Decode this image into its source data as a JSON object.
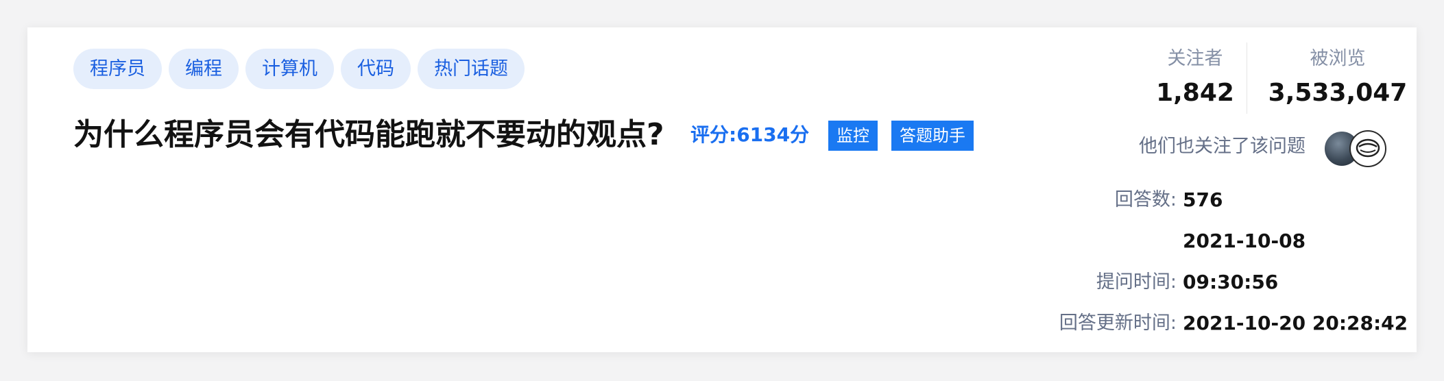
{
  "tags": [
    "程序员",
    "编程",
    "计算机",
    "代码",
    "热门话题"
  ],
  "question": {
    "title": "为什么程序员会有代码能跑就不要动的观点?",
    "score_label": "评分:",
    "score_value": "6134分"
  },
  "actions": {
    "monitor_label": "监控",
    "assistant_label": "答题助手"
  },
  "stats": {
    "followers_label": "关注者",
    "followers_value": "1,842",
    "views_label": "被浏览",
    "views_value": "3,533,047"
  },
  "also_follow_label": "他们也关注了该问题",
  "meta": {
    "answers_label": "回答数:",
    "answers_value": "576",
    "date_value": "2021-10-08",
    "asked_label": "提问时间:",
    "asked_value": "09:30:56",
    "updated_label": "回答更新时间:",
    "updated_value": "2021-10-20 20:28:42"
  },
  "colors": {
    "accent": "#1a79f2",
    "tag_bg": "#e5eefc",
    "tag_text": "#1a5fe0",
    "muted_text": "#8590a6"
  }
}
